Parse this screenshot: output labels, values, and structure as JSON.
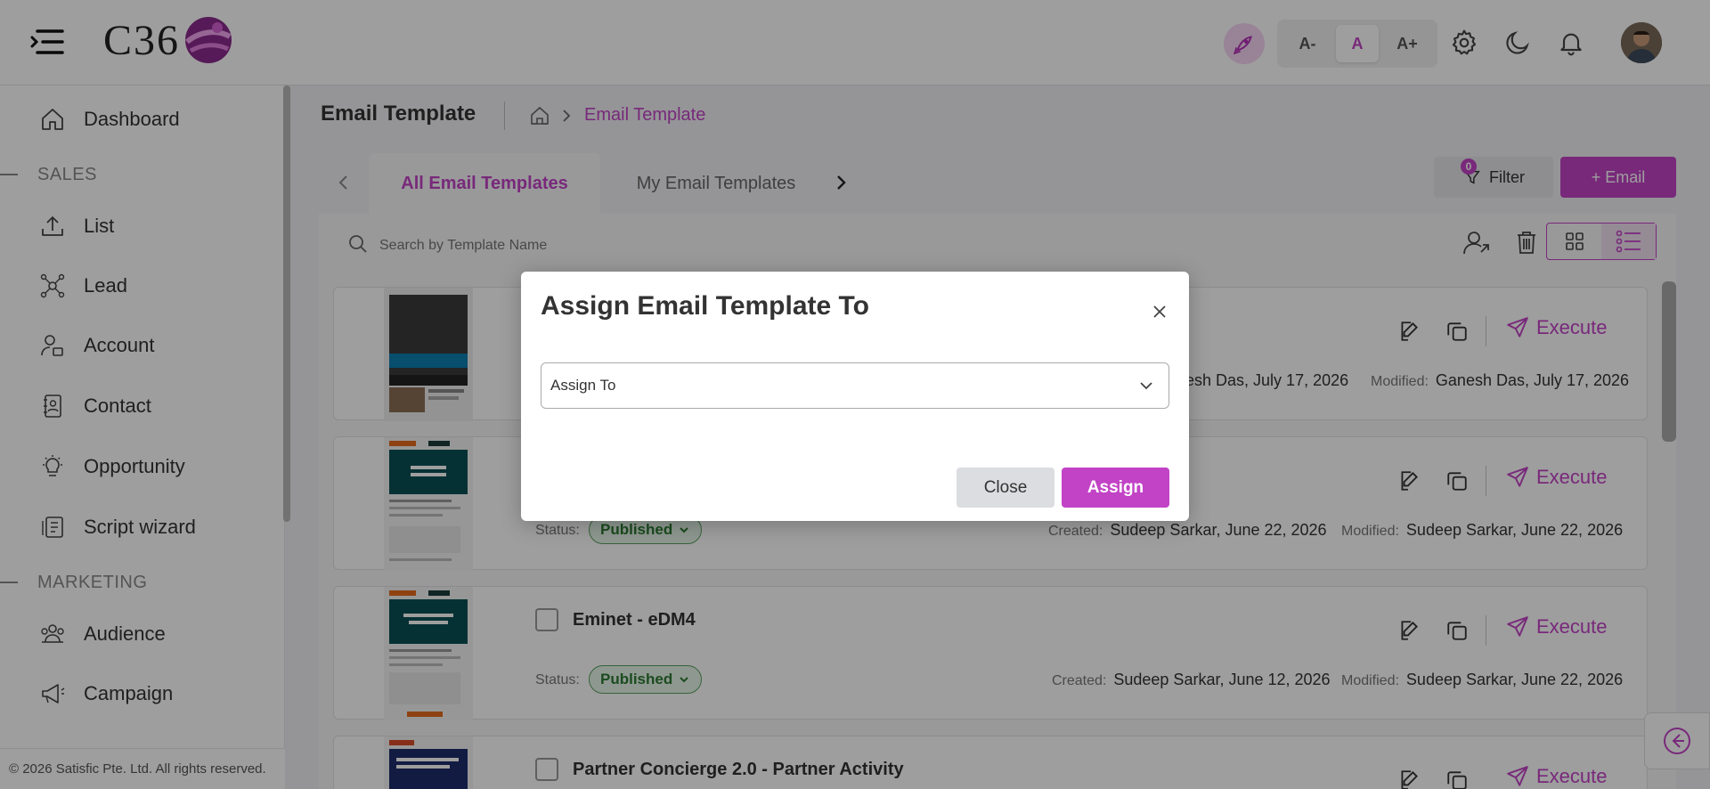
{
  "app": {
    "logo_text": "C36",
    "brand_color": "#c243c6"
  },
  "header": {
    "font_small": "A-",
    "font_normal": "A",
    "font_large": "A+",
    "icons": [
      "rocket-icon",
      "gear-icon",
      "moon-icon",
      "bell-icon",
      "user-avatar"
    ]
  },
  "sidebar": {
    "items": [
      {
        "label": "Dashboard",
        "icon": "home-icon"
      },
      {
        "label": "List",
        "icon": "upload-icon"
      },
      {
        "label": "Lead",
        "icon": "network-icon"
      },
      {
        "label": "Account",
        "icon": "user-lock-icon"
      },
      {
        "label": "Contact",
        "icon": "contact-book-icon"
      },
      {
        "label": "Opportunity",
        "icon": "lightbulb-icon"
      },
      {
        "label": "Script wizard",
        "icon": "script-icon"
      },
      {
        "label": "Audience",
        "icon": "group-icon"
      },
      {
        "label": "Campaign",
        "icon": "megaphone-icon"
      }
    ],
    "sections": [
      "SALES",
      "MARKETING"
    ]
  },
  "footer": {
    "text": "© 2026 Satisfic Pte. Ltd. All rights reserved."
  },
  "page": {
    "title": "Email Template",
    "breadcrumb_active": "Email Template"
  },
  "tabs": [
    "All Email Templates",
    "My Email Templates"
  ],
  "toolbar": {
    "filter_label": "Filter",
    "filter_count": "0",
    "email_label": "+ Email",
    "search_placeholder": "Search by Template Name"
  },
  "cards": [
    {
      "title": "",
      "status": "",
      "created_label": "",
      "created": "nesh Das, July 17, 2026",
      "modified_label": "Modified:",
      "modified": "Ganesh Das, July 17, 2026",
      "execute": "Execute"
    },
    {
      "title": "",
      "status": "Published",
      "created_label": "Created:",
      "created": "Sudeep Sarkar, June 22, 2026",
      "modified_label": "Modified:",
      "modified": "Sudeep Sarkar, June 22, 2026",
      "execute": "Execute"
    },
    {
      "title": "Eminet - eDM4",
      "status": "Published",
      "created_label": "Created:",
      "created": "Sudeep Sarkar, June 12, 2026",
      "modified_label": "Modified:",
      "modified": "Sudeep Sarkar, June 22, 2026",
      "execute": "Execute"
    },
    {
      "title": "Partner Concierge 2.0 - Partner Activity",
      "status": "",
      "execute": "Execute"
    }
  ],
  "status_label": "Status:",
  "modal": {
    "title": "Assign Email Template To",
    "select_placeholder": "Assign To",
    "close_label": "Close",
    "assign_label": "Assign"
  }
}
